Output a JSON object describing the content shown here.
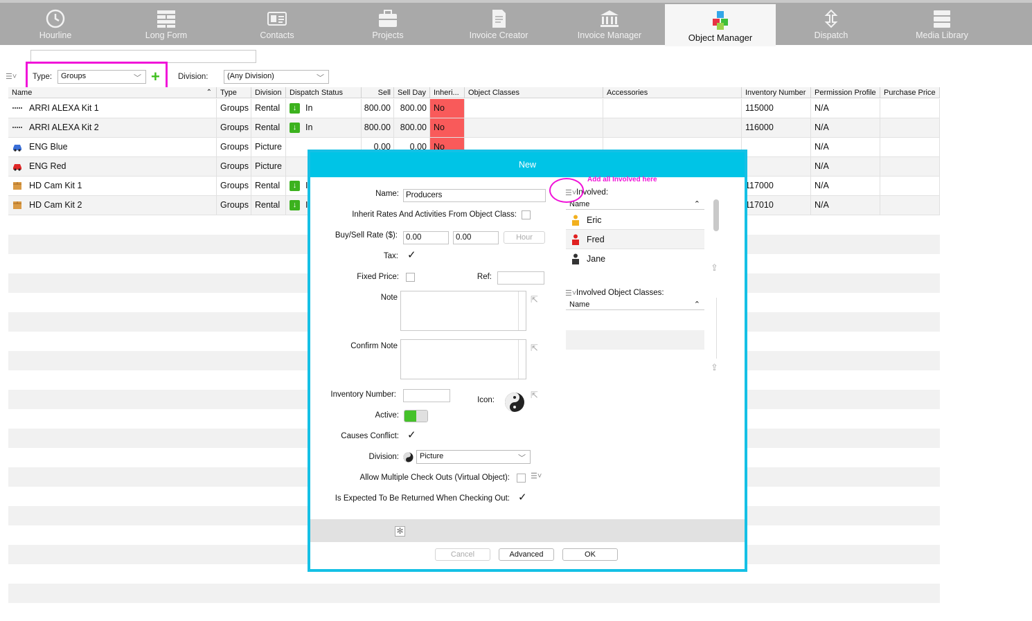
{
  "toolbar": {
    "tabs": [
      {
        "label": "Hourline",
        "icon": "clock-icon"
      },
      {
        "label": "Long Form",
        "icon": "brick-wall-icon"
      },
      {
        "label": "Contacts",
        "icon": "contact-card-icon"
      },
      {
        "label": "Projects",
        "icon": "briefcase-icon"
      },
      {
        "label": "Invoice Creator",
        "icon": "receipt-icon"
      },
      {
        "label": "Invoice Manager",
        "icon": "bank-icon"
      },
      {
        "label": "Object Manager",
        "icon": "cubes-icon",
        "active": true
      },
      {
        "label": "Dispatch",
        "icon": "up-down-arrows-icon"
      },
      {
        "label": "Media Library",
        "icon": "server-icon"
      }
    ]
  },
  "filters": {
    "search_value": "",
    "type_label": "Type:",
    "type_value": "Groups",
    "division_label": "Division:",
    "division_value": "(Any Division)"
  },
  "table": {
    "columns": [
      "Name",
      "Type",
      "Division",
      "Dispatch Status",
      "Sell",
      "Sell Day",
      "Inheri...",
      "Object Classes",
      "Accessories",
      "Inventory Number",
      "Permission Profile",
      "Purchase Price"
    ],
    "rows": [
      {
        "name": "ARRI ALEXA Kit 1",
        "icon": "camera-rig-icon",
        "type": "Groups",
        "division": "Rental",
        "dispatch": "In",
        "sell": "800.00",
        "sell_day": "800.00",
        "inherit": "No",
        "inventory": "115000",
        "permission": "N/A"
      },
      {
        "name": "ARRI ALEXA Kit 2",
        "icon": "camera-rig-icon",
        "type": "Groups",
        "division": "Rental",
        "dispatch": "In",
        "sell": "800.00",
        "sell_day": "800.00",
        "inherit": "No",
        "inventory": "116000",
        "permission": "N/A"
      },
      {
        "name": "ENG Blue",
        "icon": "blue-car-icon",
        "type": "Groups",
        "division": "Picture",
        "dispatch": "",
        "sell": "0.00",
        "sell_day": "0.00",
        "inherit": "No",
        "inventory": "",
        "permission": "N/A"
      },
      {
        "name": "ENG Red",
        "icon": "red-car-icon",
        "type": "Groups",
        "division": "Picture",
        "dispatch": "",
        "sell": "",
        "sell_day": "",
        "inherit": "",
        "inventory": "",
        "permission": "N/A"
      },
      {
        "name": "HD Cam Kit 1",
        "icon": "box-icon",
        "type": "Groups",
        "division": "Rental",
        "dispatch": "I",
        "sell": "",
        "sell_day": "",
        "inherit": "",
        "inventory": "117000",
        "permission": "N/A"
      },
      {
        "name": "HD Cam Kit 2",
        "icon": "box-icon",
        "type": "Groups",
        "division": "Rental",
        "dispatch": "I",
        "sell": "",
        "sell_day": "",
        "inherit": "",
        "inventory": "117010",
        "permission": "N/A"
      }
    ]
  },
  "dialog": {
    "title": "New",
    "name_label": "Name:",
    "name_value": "Producers",
    "inherit_label": "Inherit Rates And Activities From Object Class:",
    "rate_label": "Buy/Sell Rate ($):",
    "buy_value": "0.00",
    "sell_value": "0.00",
    "hour_label": "Hour",
    "tax_label": "Tax:",
    "fixed_label": "Fixed Price:",
    "ref_label": "Ref:",
    "ref_value": "",
    "note_label": "Note",
    "confirm_note_label": "Confirm Note",
    "inventory_label": "Inventory Number:",
    "inventory_value": "",
    "icon_label": "Icon:",
    "active_label": "Active:",
    "active_on": true,
    "conflict_label": "Causes Conflict:",
    "division_label": "Division:",
    "division_value": "Picture",
    "multi_label": "Allow Multiple Check Outs (Virtual Object):",
    "returned_label": "Is Expected To Be Returned When Checking Out:",
    "cancel_label": "Cancel",
    "advanced_label": "Advanced",
    "ok_label": "OK",
    "involved_label": "Involved:",
    "involved_annotation": "Add all Involved here",
    "involved_header": "Name",
    "involved": [
      {
        "name": "Eric",
        "color": "#f2b01e"
      },
      {
        "name": "Fred",
        "color": "#e02020"
      },
      {
        "name": "Jane",
        "color": "#333333"
      }
    ],
    "classes_label": "Involved Object Classes:",
    "classes_header": "Name"
  },
  "colors": {
    "accent": "#00c4e6",
    "highlight": "#f013d8",
    "inherit_no": "#f95a5a",
    "green": "#3cb21e"
  }
}
